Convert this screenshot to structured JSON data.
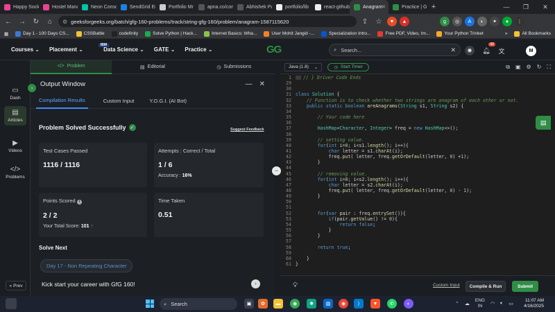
{
  "browser": {
    "tabs": [
      {
        "label": "Happy Socks",
        "color": "#e84393"
      },
      {
        "label": "Hostel Mana",
        "color": "#e84393"
      },
      {
        "label": "Neon Conso",
        "color": "#00c2a8"
      },
      {
        "label": "SendGrid En",
        "color": "#1a82e2"
      },
      {
        "label": "Portfolio Mr",
        "color": "#cccccc"
      },
      {
        "label": "apna.co/com",
        "color": "#555555"
      },
      {
        "label": "Abhishek Pa",
        "color": "#555555"
      },
      {
        "label": "portfolio/lib",
        "color": "#eeeeee"
      },
      {
        "label": "react-github",
        "color": "#eeeeee"
      },
      {
        "label": "Anagram",
        "color": "#2f8d46"
      },
      {
        "label": "Practice | Gr",
        "color": "#2f8d46"
      }
    ],
    "url": "geeksforgeeks.org/batch/gfg-160-problems/track/string-gfg-160/problem/anagram-1587115620",
    "bookmarks": [
      {
        "label": "Day 1 - 100 Days CS...",
        "color": "#3c78d8"
      },
      {
        "label": "CSSBattle",
        "color": "#f1c232"
      },
      {
        "label": "codefinity",
        "color": "#222222"
      },
      {
        "label": "Solve Python | Hack...",
        "color": "#1ba94c"
      },
      {
        "label": "Internet Basics: Wha...",
        "color": "#8bc34a"
      },
      {
        "label": "User Mohit Jangid -...",
        "color": "#f48024"
      },
      {
        "label": "Specialization Intro...",
        "color": "#0056d2"
      },
      {
        "label": "Free PDF, Video, Im...",
        "color": "#e53935"
      },
      {
        "label": "Your Python Trinket",
        "color": "#f9a825"
      }
    ],
    "all_bookmarks": "All Bookmarks"
  },
  "site": {
    "menu": [
      "Courses",
      "Placement",
      "Data Science",
      "GATE",
      "Practice"
    ],
    "ibm_badge": "IBM",
    "logo": "GG",
    "search_placeholder": "Search...",
    "notif_count": "42",
    "avatar": "M"
  },
  "rail": {
    "items": [
      "Dash",
      "Articles",
      "Videos",
      "Problems"
    ],
    "prev": "Prev"
  },
  "problem_tabs": [
    "Problem",
    "Editorial",
    "Submissions"
  ],
  "output": {
    "title": "Output Window",
    "tabs": [
      "Compilation Results",
      "Custom Input",
      "Y.O.G.I. (AI Bot)"
    ],
    "status": "Problem Solved Successfully",
    "suggest_feedback": "Suggest Feedback",
    "test_cases_label": "Test Cases Passed",
    "test_cases_value": "1116 / 1116",
    "attempts_label": "Attempts : Correct / Total",
    "attempts_value": "1 / 6",
    "accuracy_label": "Accuracy :",
    "accuracy_value": "16%",
    "points_label": "Points Scored",
    "points_value": "2 / 2",
    "total_score_label": "Your Total Score:",
    "total_score_value": "101",
    "time_label": "Time Taken",
    "time_value": "0.51",
    "solve_next": "Solve Next",
    "next_problem": "Day 17 - Non Repeating Character",
    "kickstart": "Kick start your career with GfG 160!"
  },
  "editor": {
    "language": "Java (1.8)",
    "timer": "Start Timer",
    "lines": [
      {
        "n": "1",
        "t": "// } Driver Code Ends"
      },
      {
        "n": "29",
        "t": ""
      },
      {
        "n": "30",
        "t": ""
      },
      {
        "n": "31",
        "t": "class Solution {"
      },
      {
        "n": "32",
        "t": "    // Function is to check whether two strings are anagram of each other or not."
      },
      {
        "n": "33",
        "t": "    public static boolean areAnagrams(String s1, String s2) {"
      },
      {
        "n": "34",
        "t": ""
      },
      {
        "n": "35",
        "t": "        // Your code here"
      },
      {
        "n": "36",
        "t": ""
      },
      {
        "n": "37",
        "t": "        HashMap<Character, Integer> freq = new HashMap<>();"
      },
      {
        "n": "38",
        "t": ""
      },
      {
        "n": "39",
        "t": "        // setting value."
      },
      {
        "n": "40",
        "t": "        for(int i=0; i<s1.length(); i++){"
      },
      {
        "n": "41",
        "t": "            char letter = s1.charAt(i);"
      },
      {
        "n": "42",
        "t": "            freq.put( letter, freq.getOrDefault(letter, 0) +1);"
      },
      {
        "n": "43",
        "t": "        }"
      },
      {
        "n": "44",
        "t": ""
      },
      {
        "n": "45",
        "t": "        // removing value."
      },
      {
        "n": "46",
        "t": "        for(int i=0; i<s2.length(); i++){"
      },
      {
        "n": "47",
        "t": "            char letter = s2.charAt(i);"
      },
      {
        "n": "48",
        "t": "            freq.put( letter, freq.getOrDefault(letter, 0) - 1);"
      },
      {
        "n": "49",
        "t": "        }"
      },
      {
        "n": "50",
        "t": ""
      },
      {
        "n": "51",
        "t": ""
      },
      {
        "n": "52",
        "t": "        for(var pair : freq.entrySet()){"
      },
      {
        "n": "53",
        "t": "            if(pair.getValue() != 0){"
      },
      {
        "n": "54",
        "t": "                return false;"
      },
      {
        "n": "55",
        "t": "            }"
      },
      {
        "n": "56",
        "t": "        }"
      },
      {
        "n": "57",
        "t": ""
      },
      {
        "n": "58",
        "t": "        return true;"
      },
      {
        "n": "59",
        "t": ""
      },
      {
        "n": "60",
        "t": "    }"
      },
      {
        "n": "61",
        "t": "}"
      }
    ],
    "custom_input": "Custom Input",
    "compile_run": "Compile & Run",
    "submit": "Submit"
  },
  "taskbar": {
    "search": "Search",
    "lang_top": "ENG",
    "lang_bottom": "IN",
    "time": "11:07 AM",
    "date": "4/16/2025"
  },
  "colors": {
    "brand_green": "#2f8d46",
    "accent_blue": "#3c8cff"
  }
}
